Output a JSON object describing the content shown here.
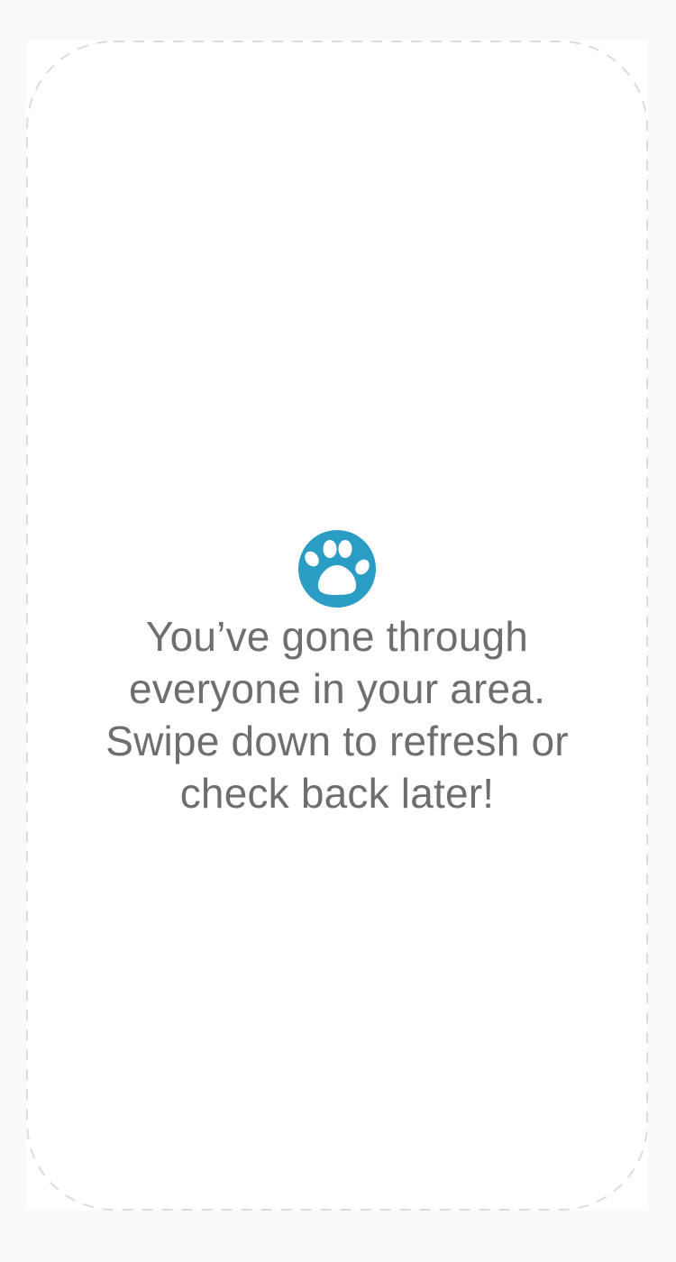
{
  "empty_state": {
    "icon": "paw-icon",
    "accent_color": "#2a9dc4",
    "message_lines": [
      "You’ve gone through",
      "everyone in your area.",
      "Swipe down to refresh or",
      "check back later!"
    ]
  }
}
